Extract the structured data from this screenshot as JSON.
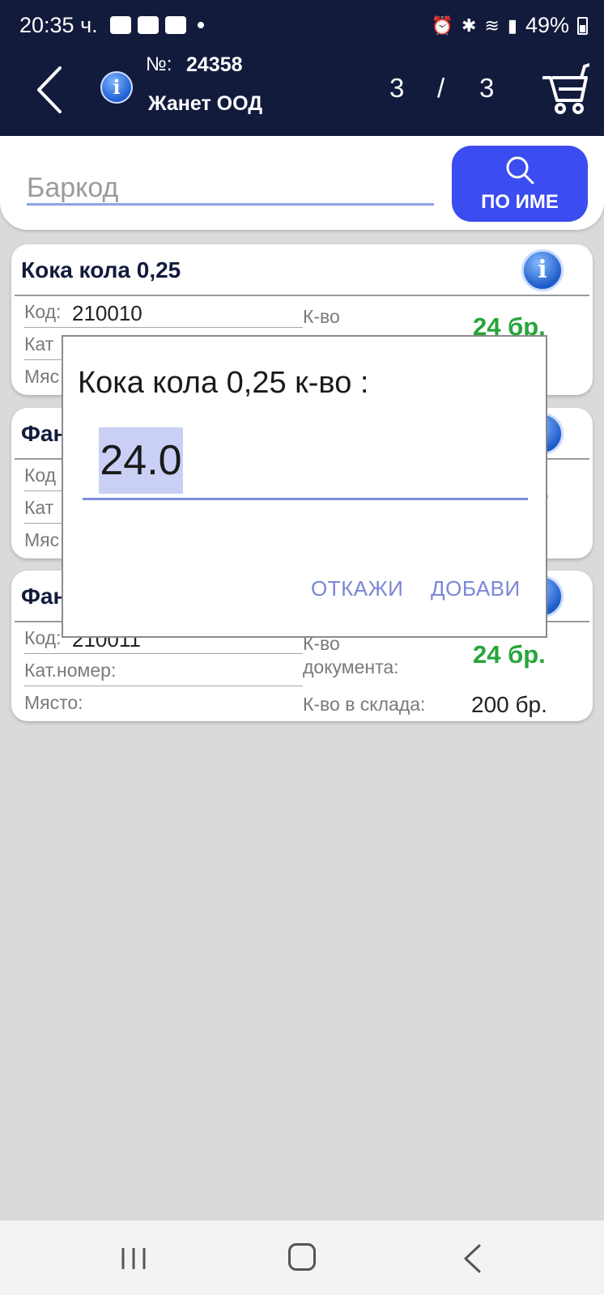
{
  "status_bar": {
    "time": "20:35 ч.",
    "battery": "49%"
  },
  "header": {
    "doc_no_label": "№:",
    "doc_no": "24358",
    "company": "Жанет ООД",
    "page_current": "3",
    "page_separator": "/",
    "page_total": "3"
  },
  "search": {
    "placeholder": "Баркод",
    "by_name_label": "ПО ИМЕ"
  },
  "products": [
    {
      "name": "Кока кола 0,25",
      "code_label": "Код:",
      "code": "210010",
      "cat_label": "Кат",
      "place_label": "Мяс",
      "qty_label": "К-во",
      "qty_doc": "24 бр.",
      "qty_stock_tail": "."
    },
    {
      "name": "Фан",
      "code_label": "Код",
      "cat_label": "Кат",
      "place_label": "Мяс",
      "qty_doc_tail": ".",
      "qty_stock_tail": "."
    },
    {
      "name": "Фан",
      "code_label": "Код:",
      "code": "210011",
      "cat_label": "Кат.номер:",
      "place_label": "Място:",
      "qty_label": "К-во документа:",
      "qty_doc": "24 бр.",
      "stock_label": "К-во в склада:",
      "qty_stock": "200 бр."
    }
  ],
  "dialog": {
    "title": "Кока кола 0,25 к-во :",
    "value": "24.0",
    "cancel_label": "ОТКАЖИ",
    "add_label": "ДОБАВИ"
  },
  "colors": {
    "header_bg": "#121b3c",
    "button_blue": "#3b4cf0",
    "qty_green": "#27a53a",
    "dialog_button": "#7b86d6"
  },
  "icons": [
    "back-arrow-icon",
    "info-icon",
    "cart-icon",
    "search-icon",
    "nav-recents-icon",
    "nav-home-icon",
    "nav-back-icon"
  ]
}
